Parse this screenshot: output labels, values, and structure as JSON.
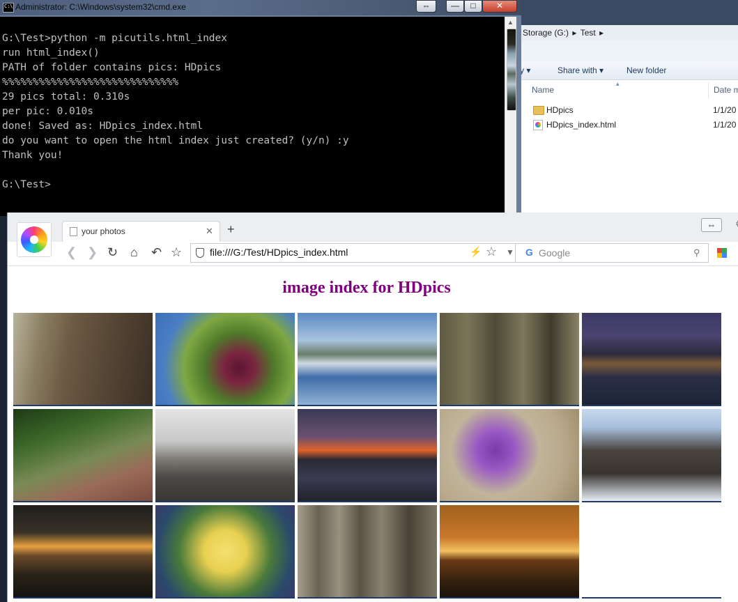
{
  "cmd": {
    "title": "Administrator: C:\\Windows\\system32\\cmd.exe",
    "lines": [
      "",
      "G:\\Test>python -m picutils.html_index",
      "run html_index()",
      "PATH of folder contains pics: HDpics",
      "%%%%%%%%%%%%%%%%%%%%%%%%%%%%%",
      "29 pics total: 0.310s",
      "per pic: 0.010s",
      "done! Saved as: HDpics_index.html",
      "do you want to open the html index just created? (y/n) :y",
      "Thank you!",
      "",
      "G:\\Test>"
    ]
  },
  "explorer": {
    "breadcrumb": [
      "Storage (G:)",
      "Test"
    ],
    "toolbar": {
      "partial_left": "y",
      "share_with": "Share with",
      "new_folder": "New folder"
    },
    "columns": {
      "name": "Name",
      "date": "Date m"
    },
    "files": [
      {
        "name": "HDpics",
        "type": "folder",
        "date": "1/1/20"
      },
      {
        "name": "HDpics_index.html",
        "type": "html",
        "date": "1/1/20"
      }
    ]
  },
  "browser": {
    "tab_title": "your photos",
    "url": "file:///G:/Test/HDpics_index.html",
    "search_placeholder": "Google",
    "page_title": "image index for HDpics",
    "thumbnails": [
      {
        "name": "lake-tree-reflection",
        "bg": "linear-gradient(180deg,#141410 0%,#2a2a22 18%,#8aa0b0 30%,#c9d7e2 45%,#5b6a60 55%,#b8c6d0 68%,#3c4a46 85%,#101010 100%)"
      },
      {
        "name": "wooden-fence-path",
        "bg": "linear-gradient(100deg,#b9b49c 0%,#8a7e62 20%,#6c5a44 40%,#5a4a38 60%,#4a3c2e 80%,#3a2e24 100%)"
      },
      {
        "name": "grapes-vine",
        "bg": "radial-gradient(circle at 60% 60%,#5a1630 0%,#7a2440 15%,#4f7a2a 35%,#7fa844 55%,#4a7fc4 75%,#3d6fb8 100%)"
      },
      {
        "name": "chapel-lake",
        "bg": "linear-gradient(180deg,#5a8ac4 0%,#a9c3de 30%,#6a7c6a 45%,#cfd9e2 55%,#3f6ea8 70%,#8fb0d4 100%)"
      },
      {
        "name": "ivy-fence",
        "bg": "linear-gradient(90deg,#5e5a42 0%,#7b7658 20%,#4d4a38 40%,#7e775c 60%,#3f3c2e 80%,#8a8266 100%)"
      },
      {
        "name": "night-town",
        "bg": "linear-gradient(180deg,#3a3a66 0%,#4b4470 25%,#2c2a3c 45%,#7a5a3a 55%,#2a2f46 70%,#1e2436 100%)"
      },
      {
        "name": "butterfly-wood",
        "bg": "linear-gradient(160deg,#1e3a16 0%,#3e6a2a 30%,#7a8a56 55%,#9a6a58 75%,#7a4a3e 100%)"
      },
      {
        "name": "stone-roof",
        "bg": "linear-gradient(180deg,#e4e4e4 0%,#c8c8c8 35%,#7c7a74 55%,#4a4844 75%,#3a3834 100%)"
      },
      {
        "name": "sunset-bay",
        "bg": "linear-gradient(180deg,#3a3a56 0%,#6a5070 30%,#e0602a 45%,#2a2a34 55%,#3a3a52 75%,#22222e 100%)"
      },
      {
        "name": "purple-flowers",
        "bg": "radial-gradient(circle at 40% 45%,#7a3aa8 0%,#9a5ac4 20%,#c0b49a 45%,#b9a98a 70%,#9a8a6a 100%)"
      },
      {
        "name": "clock-tower",
        "bg": "linear-gradient(180deg,#c8d8ec 0%,#a6bfdc 20%,#4a4440 45%,#3a3430 70%,#e6eef6 100%)"
      },
      {
        "name": "cloudy-sunset",
        "bg": "linear-gradient(180deg,#1e1e1e 0%,#3a3226 30%,#e6a040 45%,#6a4a2a 55%,#2a2418 75%,#141210 100%)"
      },
      {
        "name": "yellow-dahlia",
        "bg": "radial-gradient(circle at 50% 50%,#f4e070 0%,#e8d050 25%,#4a7a3a 55%,#2a4a6a 80%,#3a3a6a 100%)"
      },
      {
        "name": "wood-planks",
        "bg": "linear-gradient(90deg,#a89e8a 0%,#6a6254 15%,#9a907e 30%,#5a5244 45%,#8a8270 60%,#4a4236 80%,#7a7262 100%)"
      },
      {
        "name": "sailboat-sunset",
        "bg": "linear-gradient(180deg,#a0621e 0%,#c8782a 35%,#f4c060 50%,#6a3a16 60%,#3a2410 80%,#1a120a 100%)"
      }
    ]
  }
}
